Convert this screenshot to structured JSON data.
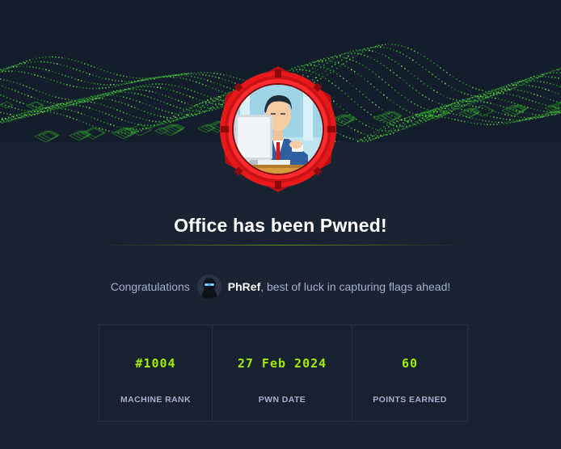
{
  "title": "Office has been Pwned!",
  "congrats": {
    "prefix": "Congratulations",
    "username": "PhRef",
    "suffix": ", best of luck in capturing flags ahead!"
  },
  "stats": [
    {
      "value": "#1004",
      "label": "MACHINE RANK"
    },
    {
      "value": "27 Feb 2024",
      "label": "PWN DATE"
    },
    {
      "value": "60",
      "label": "POINTS EARNED"
    }
  ],
  "colors": {
    "background": "#1a2332",
    "accent": "#9fef00",
    "muted_text": "#a4b1cd",
    "ring": "#e8191c"
  },
  "icons": {
    "machine_avatar": "office-worker-avatar-icon",
    "user_avatar": "hooded-user-avatar-icon"
  }
}
